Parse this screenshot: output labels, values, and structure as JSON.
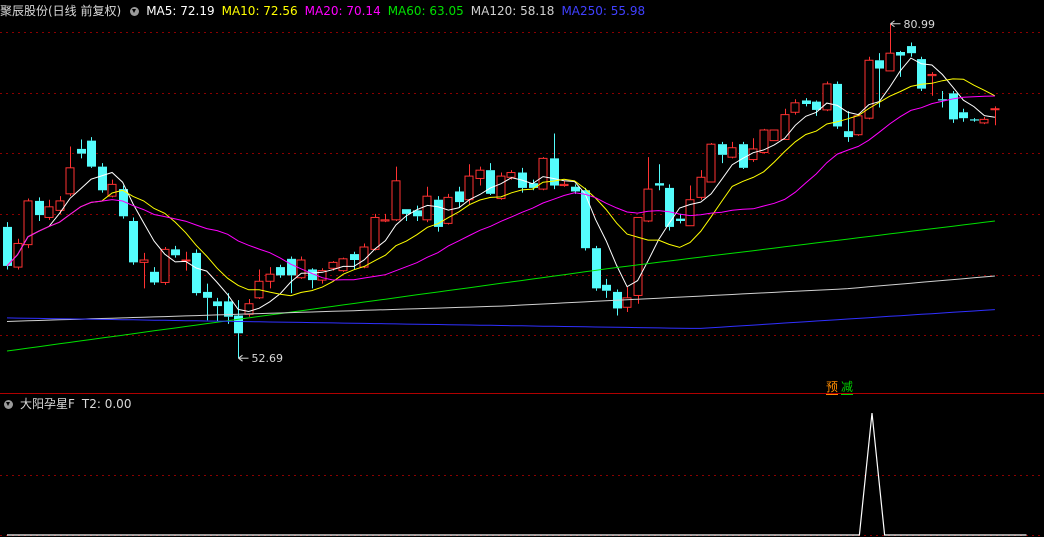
{
  "header": {
    "title": "聚辰股份(日线 前复权)",
    "ma": [
      {
        "label": "MA5: 72.19",
        "color": "#ffffff"
      },
      {
        "label": "MA10: 72.56",
        "color": "#ffff00"
      },
      {
        "label": "MA20: 70.14",
        "color": "#ff00ff"
      },
      {
        "label": "MA60: 63.05",
        "color": "#00e000"
      },
      {
        "label": "MA120: 58.18",
        "color": "#d0d0d0"
      },
      {
        "label": "MA250: 55.98",
        "color": "#4040ff"
      }
    ]
  },
  "sub_header": {
    "title": "大阳孕星F",
    "value_label": "T2: 0.00"
  },
  "badges": {
    "yu": "预",
    "jian": "减"
  },
  "colors": {
    "up": "#ff3232",
    "down": "#54fcfc",
    "grid": "#8b0000",
    "ma5": "#ffffff",
    "ma10": "#ffff00",
    "ma20": "#ff00ff",
    "ma60": "#00e000",
    "ma120": "#d0d0d0",
    "ma250": "#3030ff",
    "indicator": "#ffffff"
  },
  "chart_data": {
    "type": "candlestick",
    "ylim": [
      50,
      83
    ],
    "max_marker": {
      "label": "80.99",
      "value": 80.99
    },
    "min_marker": {
      "label": "52.69",
      "value": 52.69
    },
    "candles": [
      [
        63.8,
        60.5,
        64.2,
        60.2
      ],
      [
        60.4,
        62.4,
        62.8,
        60.2
      ],
      [
        62.3,
        66.0,
        66.2,
        62.0
      ],
      [
        66.0,
        64.8,
        66.3,
        64.3
      ],
      [
        64.6,
        65.5,
        66.1,
        64.4
      ],
      [
        65.2,
        66.0,
        66.4,
        64.9
      ],
      [
        66.6,
        68.8,
        70.6,
        66.4
      ],
      [
        70.4,
        70.0,
        71.2,
        69.6
      ],
      [
        71.1,
        68.9,
        71.4,
        68.8
      ],
      [
        68.9,
        66.9,
        69.2,
        66.7
      ],
      [
        66.4,
        67.4,
        67.8,
        66.3
      ],
      [
        67.0,
        64.7,
        67.3,
        64.5
      ],
      [
        64.3,
        60.8,
        64.6,
        60.6
      ],
      [
        60.8,
        61.0,
        61.6,
        58.6
      ],
      [
        60.0,
        59.1,
        60.4,
        58.9
      ],
      [
        59.1,
        61.9,
        62.1,
        58.9
      ],
      [
        61.9,
        61.4,
        62.2,
        61.2
      ],
      [
        61.0,
        61.0,
        61.7,
        60.1
      ],
      [
        61.6,
        58.2,
        61.9,
        58.0
      ],
      [
        58.3,
        57.8,
        59.0,
        55.9
      ],
      [
        57.5,
        57.1,
        57.8,
        55.8
      ],
      [
        57.5,
        56.2,
        58.2,
        55.6
      ],
      [
        56.3,
        54.8,
        57.6,
        52.69
      ],
      [
        56.4,
        57.3,
        57.7,
        56.2
      ],
      [
        57.8,
        59.2,
        60.2,
        57.7
      ],
      [
        59.2,
        59.8,
        60.4,
        58.6
      ],
      [
        60.4,
        59.7,
        60.6,
        59.5
      ],
      [
        61.1,
        59.7,
        61.3,
        58.2
      ],
      [
        59.5,
        61.0,
        61.3,
        59.4
      ],
      [
        60.2,
        59.3,
        60.3,
        58.6
      ],
      [
        59.3,
        60.1,
        60.3,
        59.0
      ],
      [
        60.3,
        60.8,
        60.9,
        60.1
      ],
      [
        60.1,
        61.1,
        61.2,
        60.0
      ],
      [
        61.5,
        61.0,
        61.7,
        60.2
      ],
      [
        60.4,
        62.1,
        62.4,
        60.3
      ],
      [
        61.9,
        64.6,
        64.9,
        61.8
      ],
      [
        64.3,
        64.4,
        64.9,
        64.2
      ],
      [
        64.4,
        67.7,
        68.9,
        64.3
      ],
      [
        65.3,
        64.9,
        65.3,
        64.3
      ],
      [
        65.2,
        64.7,
        65.6,
        64.3
      ],
      [
        64.4,
        66.4,
        67.2,
        64.2
      ],
      [
        66.1,
        63.8,
        66.4,
        63.4
      ],
      [
        64.1,
        66.3,
        66.6,
        64.0
      ],
      [
        66.8,
        65.9,
        67.2,
        65.4
      ],
      [
        66.1,
        68.1,
        69.1,
        65.7
      ],
      [
        67.9,
        68.6,
        68.9,
        67.3
      ],
      [
        68.6,
        66.6,
        69.2,
        66.5
      ],
      [
        66.2,
        68.1,
        68.4,
        66.1
      ],
      [
        68.0,
        68.4,
        68.6,
        67.8
      ],
      [
        68.4,
        67.1,
        68.8,
        66.7
      ],
      [
        67.5,
        67.1,
        67.8,
        66.9
      ],
      [
        67.0,
        69.6,
        69.7,
        66.9
      ],
      [
        69.6,
        67.3,
        71.7,
        67.0
      ],
      [
        67.3,
        67.4,
        67.7,
        67.2
      ],
      [
        67.2,
        66.8,
        67.4,
        66.6
      ],
      [
        66.9,
        62.0,
        67.1,
        61.8
      ],
      [
        62.0,
        58.6,
        62.2,
        58.4
      ],
      [
        58.9,
        58.4,
        59.4,
        57.8
      ],
      [
        58.3,
        56.9,
        58.5,
        56.3
      ],
      [
        57.0,
        57.8,
        58.7,
        56.6
      ],
      [
        58.0,
        64.6,
        64.6,
        57.3
      ],
      [
        64.3,
        67.0,
        69.7,
        64.2
      ],
      [
        67.5,
        67.3,
        69.1,
        66.9
      ],
      [
        67.1,
        63.8,
        67.4,
        63.5
      ],
      [
        64.5,
        64.3,
        64.9,
        64.1
      ],
      [
        63.9,
        66.1,
        67.3,
        63.9
      ],
      [
        66.3,
        68.0,
        68.6,
        66.1
      ],
      [
        67.6,
        70.8,
        70.9,
        67.6
      ],
      [
        70.8,
        69.9,
        71.0,
        69.2
      ],
      [
        69.7,
        70.5,
        71.0,
        69.6
      ],
      [
        70.8,
        68.8,
        71.0,
        68.7
      ],
      [
        69.5,
        70.4,
        71.3,
        69.3
      ],
      [
        70.1,
        72.0,
        72.1,
        70.0
      ],
      [
        71.1,
        72.0,
        72.0,
        71.1
      ],
      [
        71.2,
        73.3,
        73.8,
        71.2
      ],
      [
        73.5,
        74.3,
        74.6,
        73.3
      ],
      [
        74.5,
        74.2,
        74.7,
        74.0
      ],
      [
        74.4,
        73.7,
        74.5,
        73.2
      ],
      [
        73.7,
        75.9,
        76.1,
        73.6
      ],
      [
        75.9,
        72.3,
        76.1,
        72.1
      ],
      [
        71.9,
        71.4,
        73.6,
        71.0
      ],
      [
        71.6,
        73.2,
        73.4,
        71.5
      ],
      [
        73.0,
        77.9,
        78.2,
        72.9
      ],
      [
        77.9,
        77.2,
        78.5,
        73.9
      ],
      [
        77.0,
        78.5,
        80.99,
        77.0
      ],
      [
        78.6,
        78.3,
        78.7,
        76.5
      ],
      [
        79.1,
        78.5,
        79.4,
        78.2
      ],
      [
        78.0,
        75.5,
        78.2,
        75.3
      ],
      [
        76.6,
        76.7,
        76.9,
        74.9
      ],
      [
        74.6,
        74.5,
        75.3,
        73.9
      ],
      [
        75.1,
        72.9,
        75.3,
        72.6
      ],
      [
        73.5,
        73.0,
        73.8,
        72.7
      ],
      [
        72.9,
        72.8,
        73.0,
        72.7
      ],
      [
        72.6,
        72.9,
        73.1,
        72.5
      ],
      [
        73.8,
        73.8,
        74.0,
        72.4
      ]
    ],
    "indicator": {
      "name": "T2",
      "ylim": [
        0,
        1
      ],
      "spike": {
        "center": 82.3,
        "half_width": 1.2,
        "value": 1
      }
    }
  }
}
